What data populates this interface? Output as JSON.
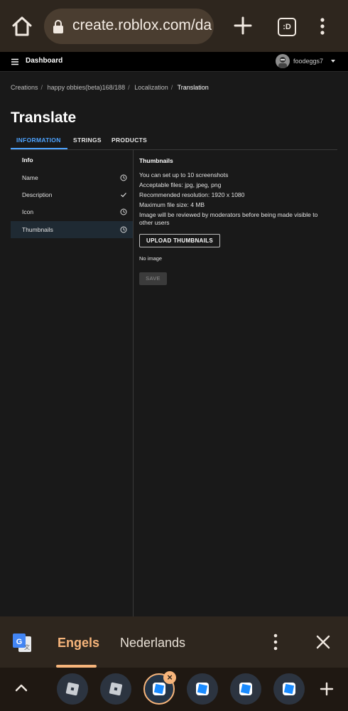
{
  "browser": {
    "url": "create.roblox.com/da",
    "tab_switcher_label": ":D"
  },
  "header": {
    "title": "Dashboard",
    "username": "foodeggs7"
  },
  "breadcrumb": {
    "items": [
      "Creations",
      "happy obbies(beta)168/188",
      "Localization",
      "Translation"
    ]
  },
  "page": {
    "title": "Translate",
    "tabs": [
      "INFORMATION",
      "STRINGS",
      "PRODUCTS"
    ],
    "active_tab": "INFORMATION"
  },
  "sidebar": {
    "heading": "Info",
    "items": [
      {
        "label": "Name",
        "status_icon": "clock-icon"
      },
      {
        "label": "Description",
        "status_icon": "check-icon"
      },
      {
        "label": "Icon",
        "status_icon": "clock-icon"
      },
      {
        "label": "Thumbnails",
        "status_icon": "clock-icon",
        "active": true
      }
    ]
  },
  "content": {
    "heading": "Thumbnails",
    "lines": [
      "You can set up to 10 screenshots",
      "Acceptable files: jpg, jpeg, png",
      "Recommended resolution: 1920 x 1080",
      "Maximum file size: 4 MB",
      "Image will be reviewed by moderators before being made visible to other users"
    ],
    "upload_label": "UPLOAD THUMBNAILS",
    "empty_text": "No image",
    "save_label": "SAVE"
  },
  "translate_bar": {
    "source_language": "Engels",
    "target_language": "Nederlands"
  },
  "tab_strip": {
    "tabs": [
      "roblox-logo-icon",
      "roblox-logo-icon",
      "roblox-studio-icon",
      "roblox-studio-icon",
      "roblox-studio-icon",
      "roblox-studio-icon"
    ],
    "active_index": 2
  },
  "colors": {
    "accent_blue": "#4da3ff",
    "accent_orange": "#f7b57b",
    "background": "#191919"
  }
}
